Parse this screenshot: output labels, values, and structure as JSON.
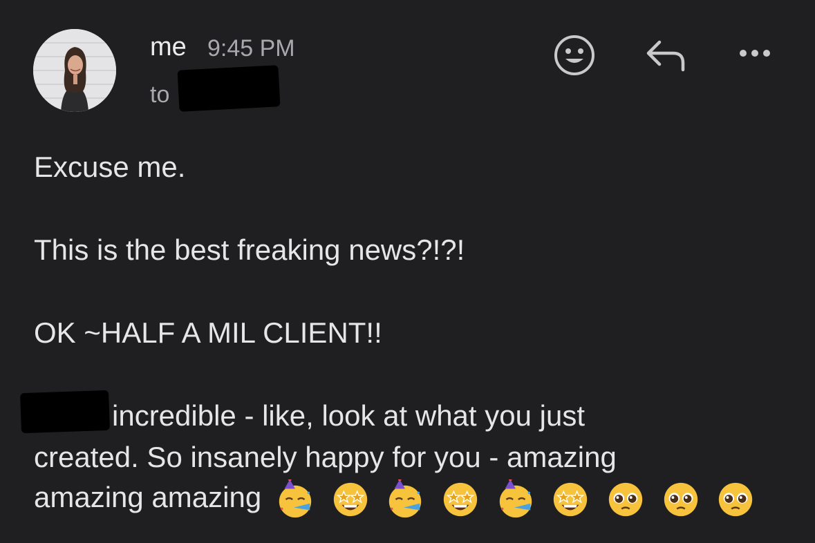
{
  "header": {
    "sender": "me",
    "time": "9:45 PM",
    "to_prefix": "to"
  },
  "actions": {
    "emoji_icon": "smiley-react-icon",
    "reply_icon": "reply-icon",
    "more_icon": "more-options-icon"
  },
  "message": {
    "line1": "Excuse me.",
    "line2": "This is the best freaking news?!?!",
    "line3": "OK ~HALF A MIL CLIENT!!",
    "line4": "incredible - like, look at what you just",
    "line5": "created. So insanely happy for you - amazing",
    "line6": "amazing amazing"
  },
  "emojis": [
    "partying-face-icon",
    "star-struck-icon",
    "partying-face-icon",
    "star-struck-icon",
    "partying-face-icon",
    "star-struck-icon",
    "pleading-face-icon",
    "pleading-face-icon",
    "pleading-face-icon"
  ],
  "colors": {
    "background": "#1f1f21",
    "primary_text": "#e6e6e6",
    "secondary_text": "#a9a9ad"
  }
}
